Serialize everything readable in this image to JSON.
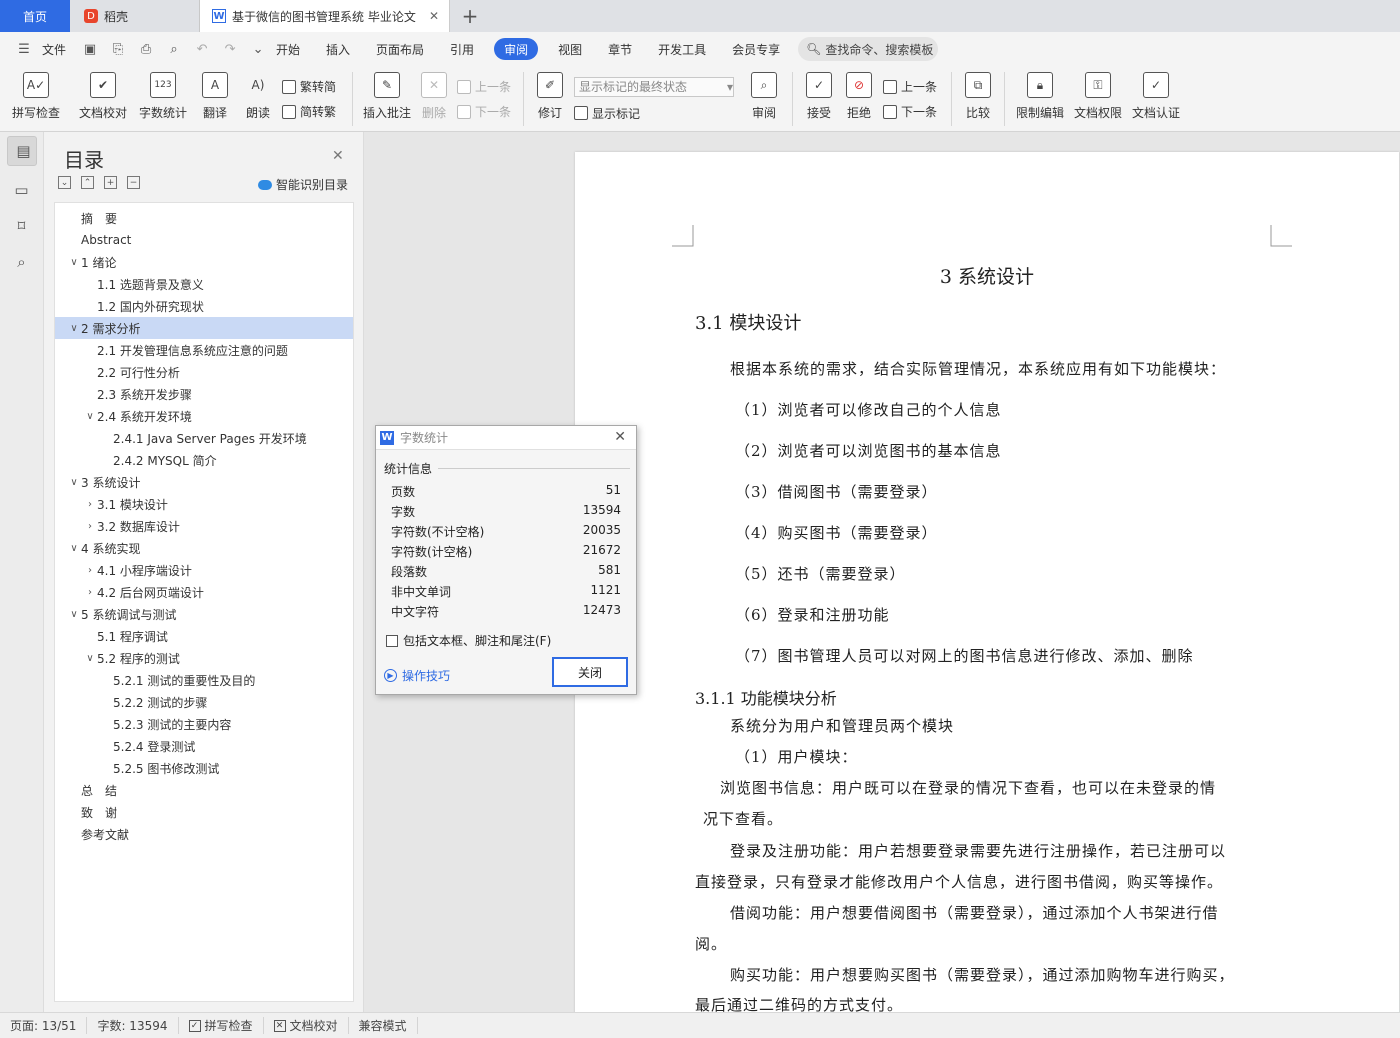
{
  "tabs": {
    "home": "首页",
    "daoke": "稻壳",
    "doc": "基于微信的图书管理系统 毕业论文",
    "new_tab": "+"
  },
  "menu": {
    "file": "文件",
    "tabs": [
      "开始",
      "插入",
      "页面布局",
      "引用",
      "审阅",
      "视图",
      "章节",
      "开发工具",
      "会员专享"
    ],
    "active_tab": "审阅",
    "search_placeholder": "查找命令、搜索模板"
  },
  "toolbar": {
    "spell": "拼写检查",
    "proof": "文档校对",
    "wordcount": "字数统计",
    "translate": "翻译",
    "read": "朗读",
    "trad_simp": "繁转简",
    "simp_trad": "简转繁",
    "insert_comment": "插入批注",
    "delete": "删除",
    "prev_comment": "上一条",
    "next_comment": "下一条",
    "track": "修订",
    "markup_state": "显示标记的最终状态",
    "show_markup": "显示标记",
    "review": "审阅",
    "accept": "接受",
    "reject": "拒绝",
    "prev": "上一条",
    "next": "下一条",
    "compare": "比较",
    "restrict": "限制编辑",
    "permission": "文档权限",
    "certify": "文档认证"
  },
  "nav": {
    "title": "目录",
    "smart_toc": "智能识别目录",
    "items": [
      {
        "label": "摘　要",
        "level": 0,
        "arrow": ""
      },
      {
        "label": "Abstract",
        "level": 0,
        "arrow": ""
      },
      {
        "label": "1 绪论",
        "level": 0,
        "arrow": "∨"
      },
      {
        "label": "1.1  选题背景及意义",
        "level": 1,
        "arrow": ""
      },
      {
        "label": "1.2  国内外研究现状",
        "level": 1,
        "arrow": ""
      },
      {
        "label": "2 需求分析",
        "level": 0,
        "arrow": "∨",
        "highlight": true
      },
      {
        "label": "2.1 开发管理信息系统应注意的问题",
        "level": 1,
        "arrow": ""
      },
      {
        "label": "2.2 可行性分析",
        "level": 1,
        "arrow": ""
      },
      {
        "label": "2.3 系统开发步骤",
        "level": 1,
        "arrow": ""
      },
      {
        "label": "2.4 系统开发环境",
        "level": 1,
        "arrow": "∨"
      },
      {
        "label": "2.4.1 Java Server Pages 开发环境",
        "level": 2,
        "arrow": ""
      },
      {
        "label": "2.4.2 MYSQL 简介",
        "level": 2,
        "arrow": ""
      },
      {
        "label": "3 系统设计",
        "level": 0,
        "arrow": "∨"
      },
      {
        "label": "3.1  模块设计",
        "level": 1,
        "arrow": "›"
      },
      {
        "label": "3.2 数据库设计",
        "level": 1,
        "arrow": "›"
      },
      {
        "label": "4 系统实现",
        "level": 0,
        "arrow": "∨"
      },
      {
        "label": "4.1 小程序端设计",
        "level": 1,
        "arrow": "›"
      },
      {
        "label": "4.2 后台网页端设计",
        "level": 1,
        "arrow": "›"
      },
      {
        "label": "5 系统调试与测试",
        "level": 0,
        "arrow": "∨"
      },
      {
        "label": "5.1  程序调试",
        "level": 1,
        "arrow": ""
      },
      {
        "label": "5.2  程序的测试",
        "level": 1,
        "arrow": "∨"
      },
      {
        "label": "5.2.1  测试的重要性及目的",
        "level": 2,
        "arrow": ""
      },
      {
        "label": "5.2.2  测试的步骤",
        "level": 2,
        "arrow": ""
      },
      {
        "label": "5.2.3  测试的主要内容",
        "level": 2,
        "arrow": ""
      },
      {
        "label": "5.2.4 登录测试",
        "level": 2,
        "arrow": ""
      },
      {
        "label": "5.2.5 图书修改测试",
        "level": 2,
        "arrow": ""
      },
      {
        "label": "总　结",
        "level": 0,
        "arrow": ""
      },
      {
        "label": "致　谢",
        "level": 0,
        "arrow": ""
      },
      {
        "label": "参考文献",
        "level": 0,
        "arrow": ""
      }
    ]
  },
  "document": {
    "h1": "3 系统设计",
    "h2": "3.1  模块设计",
    "h3": "3.1.1 功能模块分析",
    "lines": [
      "根据本系统的需求，结合实际管理情况，本系统应用有如下功能模块：",
      "（1）浏览者可以修改自己的个人信息",
      "（2）浏览者可以浏览图书的基本信息",
      "（3）借阅图书（需要登录）",
      "（4）购买图书（需要登录）",
      "（5）还书（需要登录）",
      "（6）登录和注册功能",
      "（7）图书管理人员可以对网上的图书信息进行修改、添加、删除",
      "系统分为用户和管理员两个模块",
      "（1）用户模块：",
      "浏览图书信息：用户既可以在登录的情况下查看，也可以在未登录的情",
      "况下查看。",
      "登录及注册功能：用户若想要登录需要先进行注册操作，若已注册可以",
      "直接登录，只有登录才能修改用户个人信息，进行图书借阅，购买等操作。",
      "借阅功能：用户想要借阅图书（需要登录），通过添加个人书架进行借",
      "阅。",
      "购买功能：用户想要购买图书（需要登录），通过添加购物车进行购买，",
      "最后通过二维码的方式支付。"
    ]
  },
  "dialog": {
    "title": "字数统计",
    "section": "统计信息",
    "rows": [
      {
        "label": "页数",
        "value": "51"
      },
      {
        "label": "字数",
        "value": "13594"
      },
      {
        "label": "字符数(不计空格)",
        "value": "20035"
      },
      {
        "label": "字符数(计空格)",
        "value": "21672"
      },
      {
        "label": "段落数",
        "value": "581"
      },
      {
        "label": "非中文单词",
        "value": "1121"
      },
      {
        "label": "中文字符",
        "value": "12473"
      }
    ],
    "checkbox": "包括文本框、脚注和尾注(F)",
    "tips": "操作技巧",
    "close": "关闭"
  },
  "status": {
    "page": "页面: 13/51",
    "words": "字数: 13594",
    "spell": "拼写检查",
    "proof": "文档校对",
    "compat": "兼容模式"
  }
}
